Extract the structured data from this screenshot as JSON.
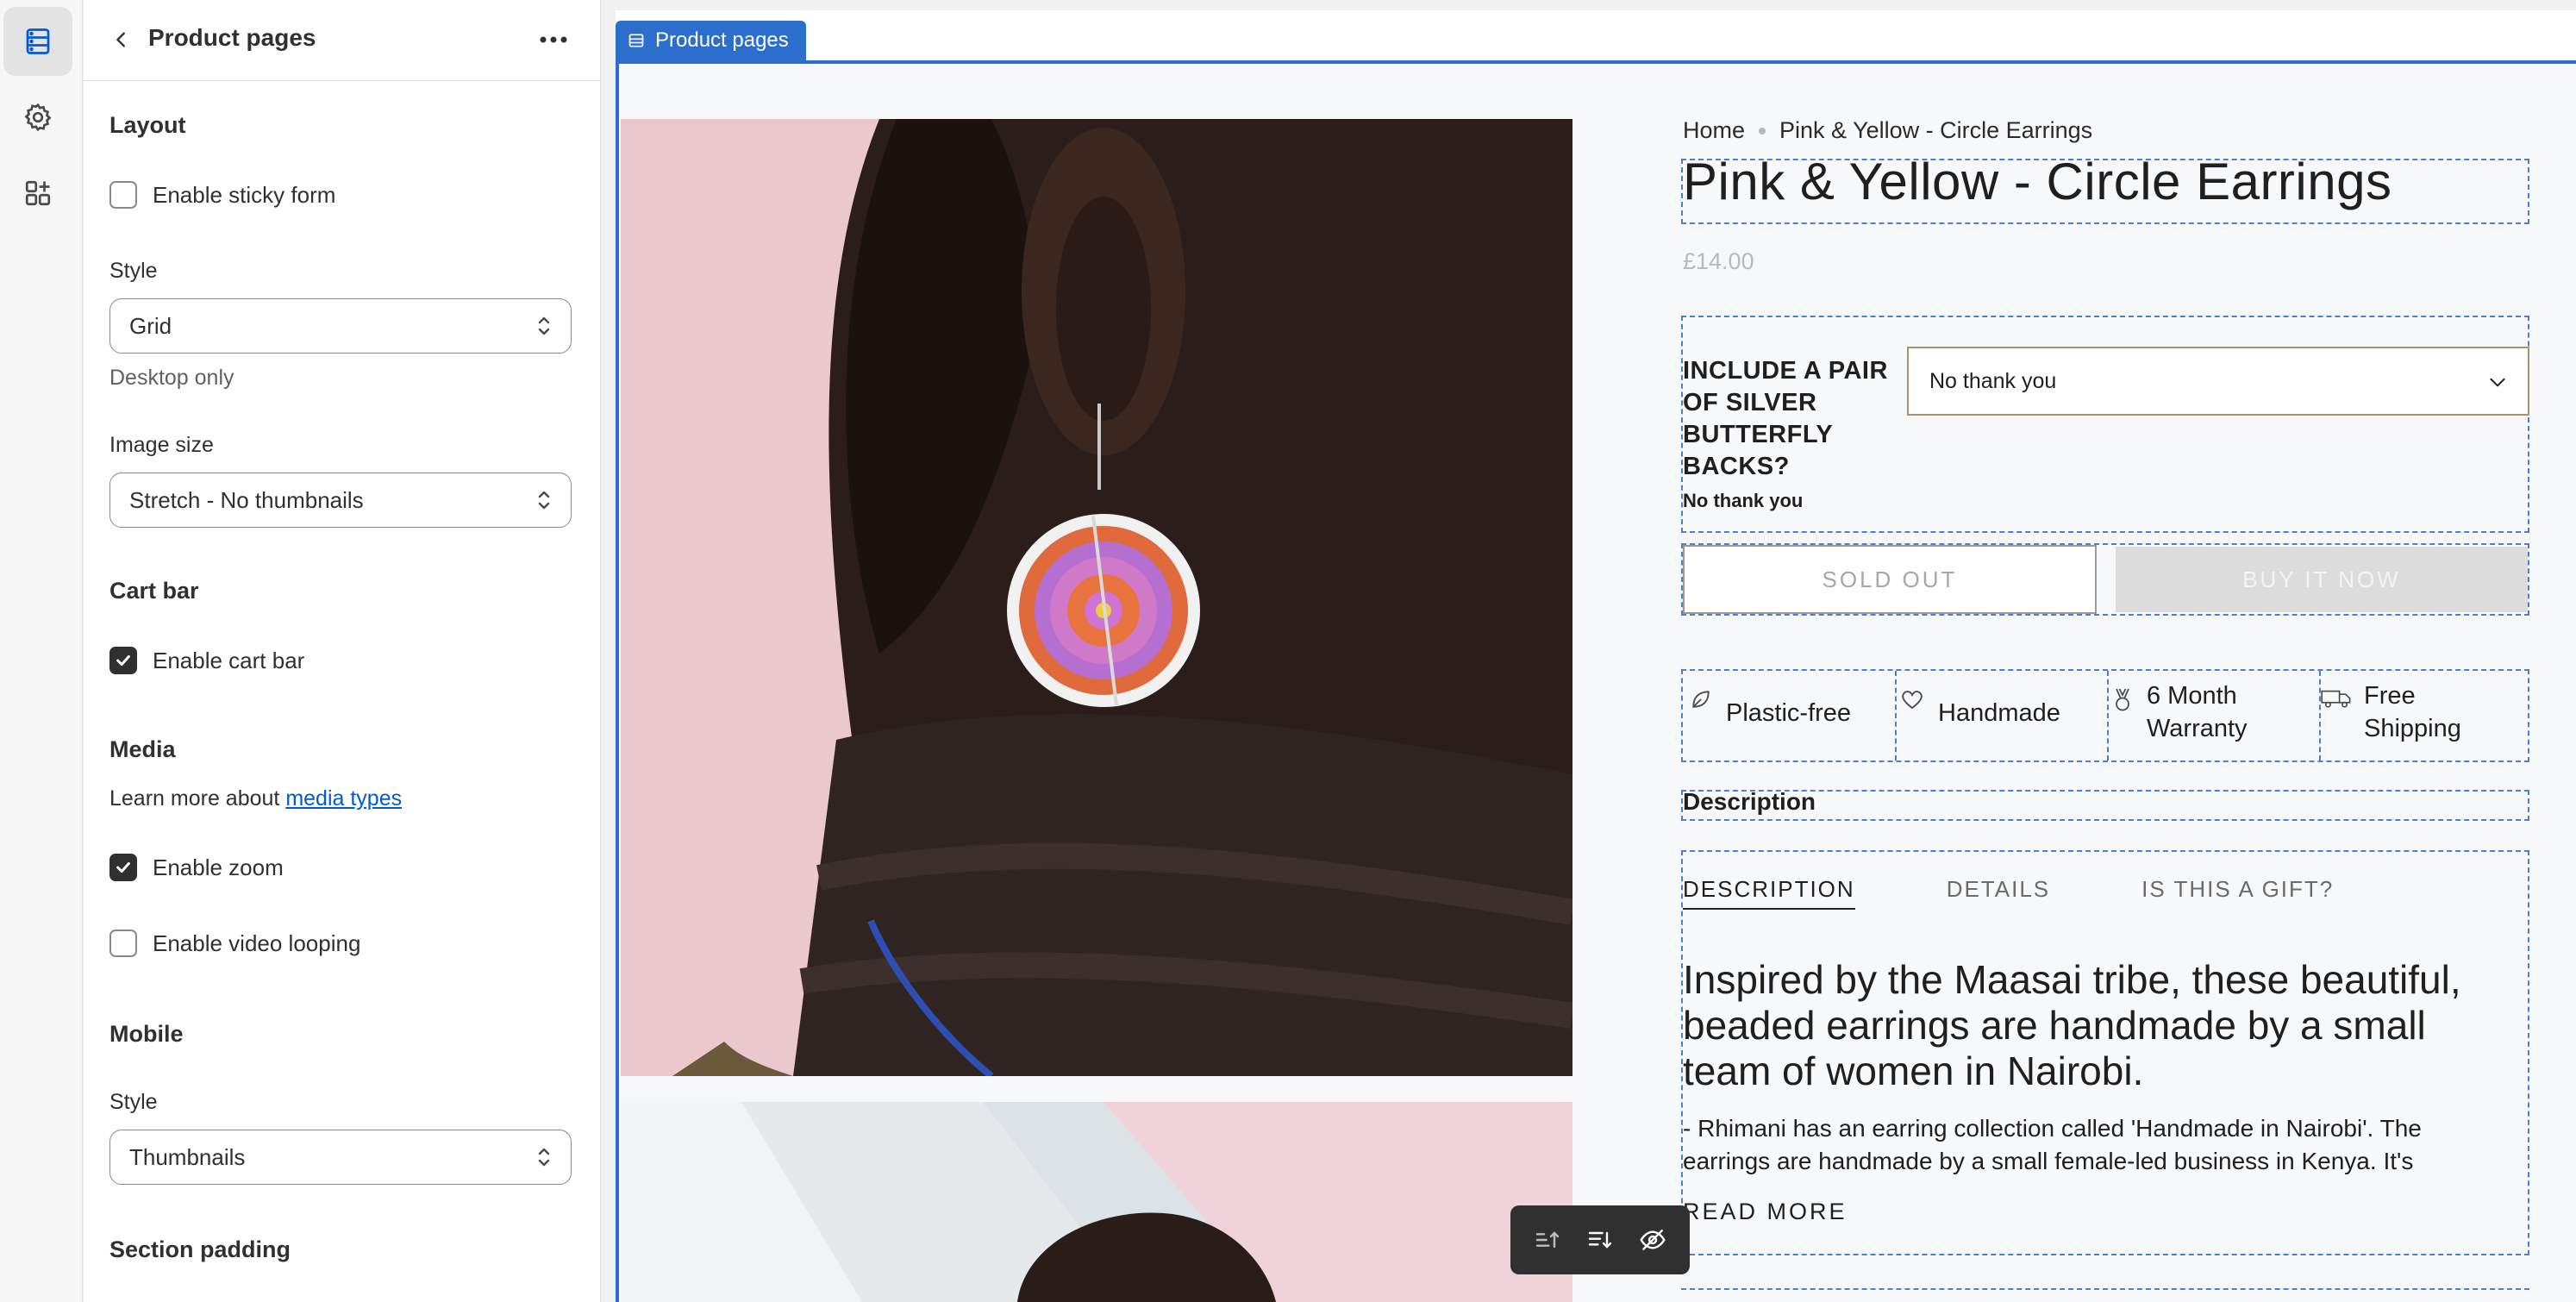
{
  "rail": {
    "items": [
      {
        "name": "sections",
        "active": true
      },
      {
        "name": "settings",
        "active": false
      },
      {
        "name": "apps",
        "active": false
      }
    ]
  },
  "panel": {
    "title": "Product pages",
    "layout": {
      "heading": "Layout",
      "sticky_form_label": "Enable sticky form",
      "sticky_form_checked": false,
      "style_label": "Style",
      "style_value": "Grid",
      "style_help": "Desktop only",
      "image_size_label": "Image size",
      "image_size_value": "Stretch - No thumbnails"
    },
    "cart_bar": {
      "heading": "Cart bar",
      "enable_label": "Enable cart bar",
      "enable_checked": true
    },
    "media": {
      "heading": "Media",
      "help_prefix": "Learn more about",
      "help_link": "media types",
      "zoom_label": "Enable zoom",
      "zoom_checked": true,
      "looping_label": "Enable video looping",
      "looping_checked": false
    },
    "mobile": {
      "heading": "Mobile",
      "style_label": "Style",
      "style_value": "Thumbnails"
    },
    "section_padding": {
      "heading": "Section padding"
    }
  },
  "preview": {
    "section_tag": "Product pages",
    "breadcrumb": [
      "Home",
      "Pink & Yellow - Circle Earrings"
    ],
    "product_title": "Pink & Yellow - Circle Earrings",
    "price": "£14.00",
    "option": {
      "label": "INCLUDE A PAIR OF SILVER BUTTERFLY BACKS?",
      "current": "No thank you",
      "select_value": "No thank you"
    },
    "buttons": {
      "sold_out": "SOLD OUT",
      "buy_now": "BUY IT NOW"
    },
    "features": [
      {
        "icon": "leaf-icon",
        "label": "Plastic-free"
      },
      {
        "icon": "heart-icon",
        "label": "Handmade"
      },
      {
        "icon": "award-icon",
        "label": "6 Month Warranty"
      },
      {
        "icon": "truck-icon",
        "label": "Free Shipping"
      }
    ],
    "description_heading": "Description",
    "tabs": [
      "DESCRIPTION",
      "DETAILS",
      "IS THIS A GIFT?"
    ],
    "description_lead": "Inspired by the Maasai tribe, these beautiful, beaded earrings are handmade by a small team of women in Nairobi.",
    "description_body": "- Rhimani has an earring collection called 'Handmade in Nairobi'. The earrings are handmade by a small female-led business in Kenya. It's",
    "read_more": "READ MORE",
    "floating_toolbar": [
      "move-icon",
      "sort-icon",
      "hide-icon"
    ]
  },
  "colors": {
    "accent": "#2c6ecb",
    "checkbox_checked": "#303030",
    "link": "#005bd3"
  }
}
